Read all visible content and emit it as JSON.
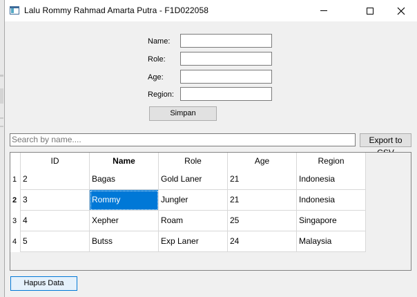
{
  "window": {
    "title": "Lalu Rommy Rahmad Amarta Putra - F1D022058"
  },
  "form": {
    "name_label": "Name:",
    "role_label": "Role:",
    "age_label": "Age:",
    "region_label": "Region:",
    "name_value": "",
    "role_value": "",
    "age_value": "",
    "region_value": "",
    "save_label": "Simpan"
  },
  "search": {
    "placeholder": "Search by name....",
    "value": ""
  },
  "export_label": "Export to CSV",
  "table": {
    "headers": [
      "ID",
      "Name",
      "Role",
      "Age",
      "Region"
    ],
    "row_numbers": [
      "1",
      "2",
      "3",
      "4"
    ],
    "rows": [
      [
        "2",
        "Bagas",
        "Gold Laner",
        "21",
        "Indonesia"
      ],
      [
        "3",
        "Rommy",
        "Jungler",
        "21",
        "Indonesia"
      ],
      [
        "4",
        "Xepher",
        "Roam",
        "25",
        "Singapore"
      ],
      [
        "5",
        "Butss",
        "Exp Laner",
        "24",
        "Malaysia"
      ]
    ],
    "selected_row": 2,
    "selected_column": "Name"
  },
  "delete_label": "Hapus Data",
  "colors": {
    "selection": "#0078d7",
    "window_bg": "#f0f0f0"
  },
  "icons": {
    "app": "app-window-icon",
    "minimize": "minimize-icon",
    "maximize": "maximize-icon",
    "close": "close-icon"
  }
}
